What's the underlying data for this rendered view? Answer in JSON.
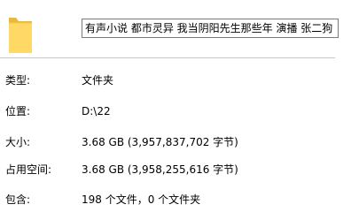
{
  "icons": {
    "folder": "folder-icon"
  },
  "folder_name": "有声小说 都市灵异 我当阴阳先生那些年 演播 张二狗",
  "colors": {
    "folder_yellow": "#ffd866",
    "folder_yellow_dark": "#e8b93c",
    "border": "#7a7a7a"
  },
  "properties": {
    "type": {
      "label": "类型:",
      "value": "文件夹"
    },
    "location": {
      "label": "位置:",
      "value": "D:\\22"
    },
    "size": {
      "label": "大小:",
      "value": "3.68 GB (3,957,837,702 字节)"
    },
    "size_on_disk": {
      "label": "占用空间:",
      "value": "3.68 GB (3,958,255,616 字节)"
    },
    "contains": {
      "label": "包含:",
      "value": "198 个文件，0 个文件夹"
    }
  }
}
